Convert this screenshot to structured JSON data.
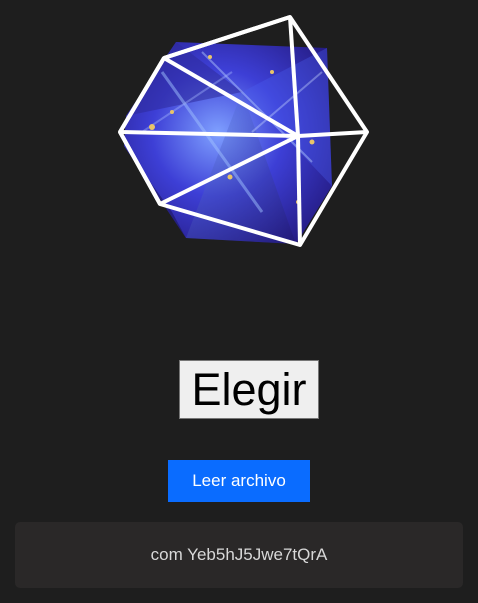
{
  "hero": {
    "icon": "icosahedron-crystal-icon",
    "colors": {
      "face_dark": "#241a7a",
      "face_mid": "#3b3fd8",
      "face_light": "#6f8cff",
      "edge": "#ffffff",
      "sparkle": "#e8c46a"
    }
  },
  "choose_button": {
    "label": "Elegir"
  },
  "read_button": {
    "label": "Leer archivo",
    "color": "#0a6cff"
  },
  "result": {
    "text": "com Yeb5hJ5Jwe7tQrA"
  }
}
